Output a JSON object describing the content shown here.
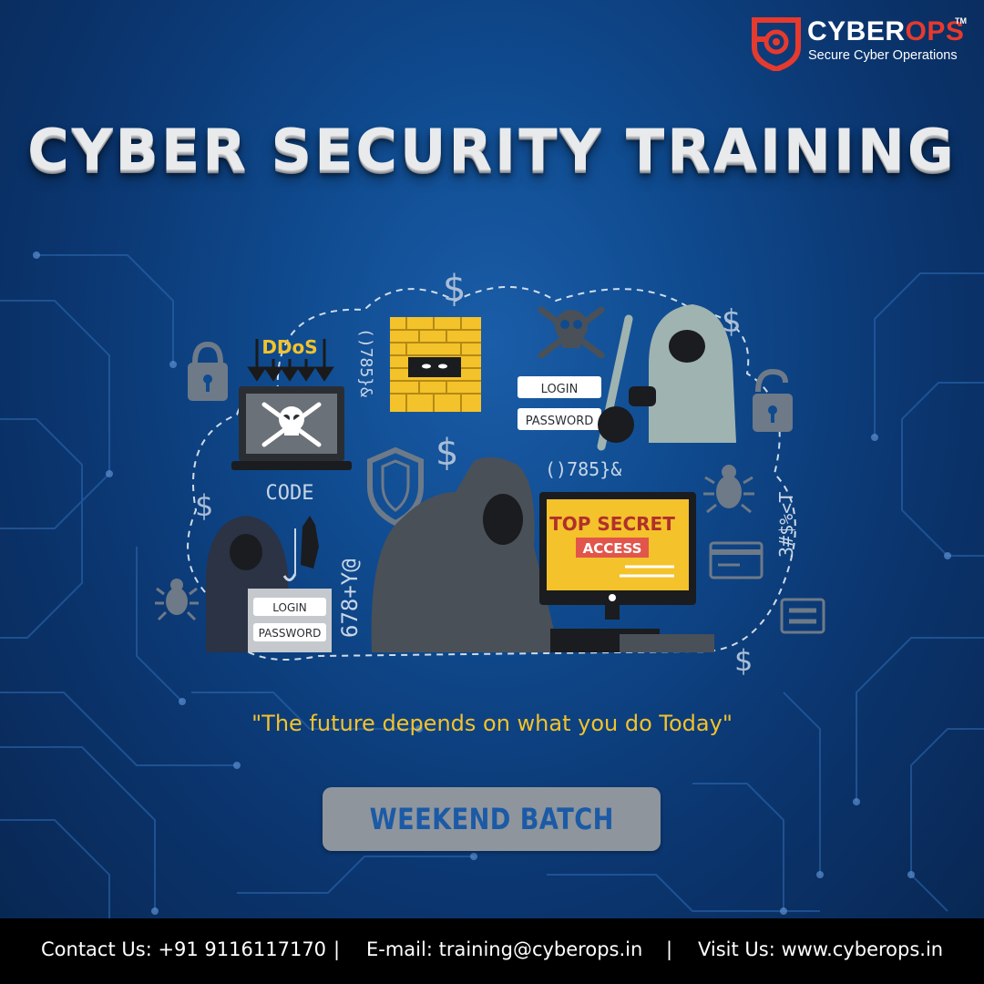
{
  "brand": {
    "name_part1": "CYBER",
    "name_part2": "OPS",
    "trademark": "TM",
    "tagline": "Secure Cyber Operations"
  },
  "title": "CYBER SECURITY TRAINING",
  "illustration": {
    "ddos_label": "DDoS",
    "code_label": "CODE",
    "login_label": "LOGIN",
    "password_label": "PASSWORD",
    "top_secret_label": "TOP SECRET",
    "access_label": "ACCESS",
    "symbols_1": "()785}&",
    "symbols_2": "()785}&",
    "symbols_3": "678+Y@",
    "symbols_4": "3#$%<T",
    "dollar": "$"
  },
  "quote": "\"The future depends on what you do Today\"",
  "batch_button": "WEEKEND BATCH",
  "footer": {
    "contact": "Contact Us: +91 9116117170",
    "separator": "|",
    "email": "E-mail: training@cyberops.in",
    "website": "Visit Us: www.cyberops.in"
  },
  "colors": {
    "background": "#0f4a8e",
    "accent_yellow": "#f4c22b",
    "brand_red": "#e63a2e",
    "figure_gray": "#4a5058",
    "footer": "#000000"
  }
}
